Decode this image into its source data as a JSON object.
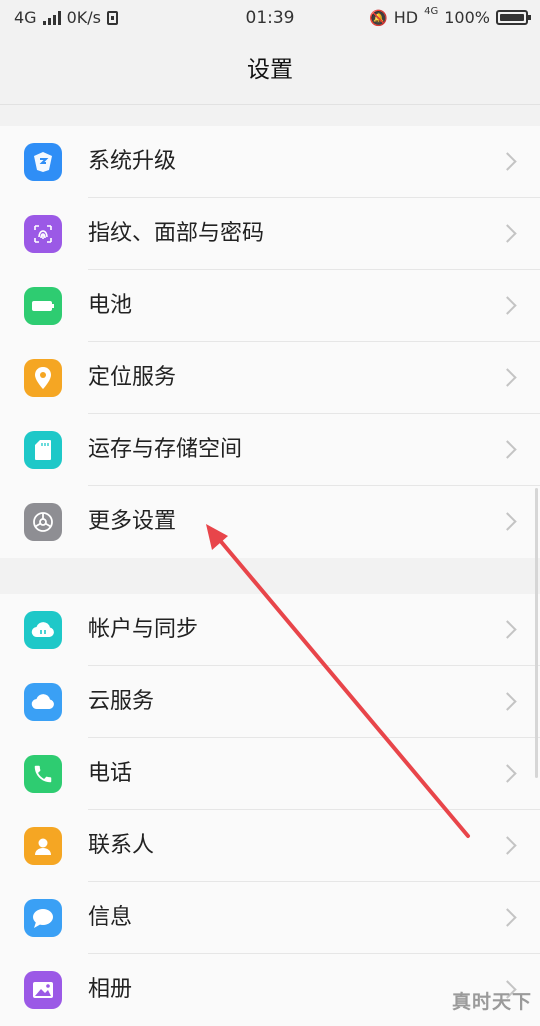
{
  "status_bar": {
    "network": "4G",
    "speed": "0K/s",
    "time": "01:39",
    "hd": "HD",
    "net_badge": "4G",
    "battery": "100%"
  },
  "header": {
    "title": "设置"
  },
  "groups": [
    {
      "items": [
        {
          "label": "系统升级",
          "icon": "system-update-icon",
          "color": "#2f8ef6"
        },
        {
          "label": "指纹、面部与密码",
          "icon": "fingerprint-icon",
          "color": "#9b59e6"
        },
        {
          "label": "电池",
          "icon": "battery-icon",
          "color": "#2ecc71"
        },
        {
          "label": "定位服务",
          "icon": "location-pin-icon",
          "color": "#f5a623"
        },
        {
          "label": "运存与存储空间",
          "icon": "sd-card-icon",
          "color": "#1ec8c8"
        },
        {
          "label": "更多设置",
          "icon": "gear-icon",
          "color": "#8e8e93"
        }
      ]
    },
    {
      "items": [
        {
          "label": "帐户与同步",
          "icon": "cloud-sync-icon",
          "color": "#1ec8c8"
        },
        {
          "label": "云服务",
          "icon": "cloud-icon",
          "color": "#3aa0f5"
        },
        {
          "label": "电话",
          "icon": "phone-icon",
          "color": "#2ecc71"
        },
        {
          "label": "联系人",
          "icon": "contact-icon",
          "color": "#f5a623"
        },
        {
          "label": "信息",
          "icon": "message-icon",
          "color": "#3aa0f5"
        },
        {
          "label": "相册",
          "icon": "album-icon",
          "color": "#9b59e6"
        }
      ]
    }
  ],
  "annotation": {
    "arrow_color": "#e8454a"
  },
  "watermark": "真时天下"
}
